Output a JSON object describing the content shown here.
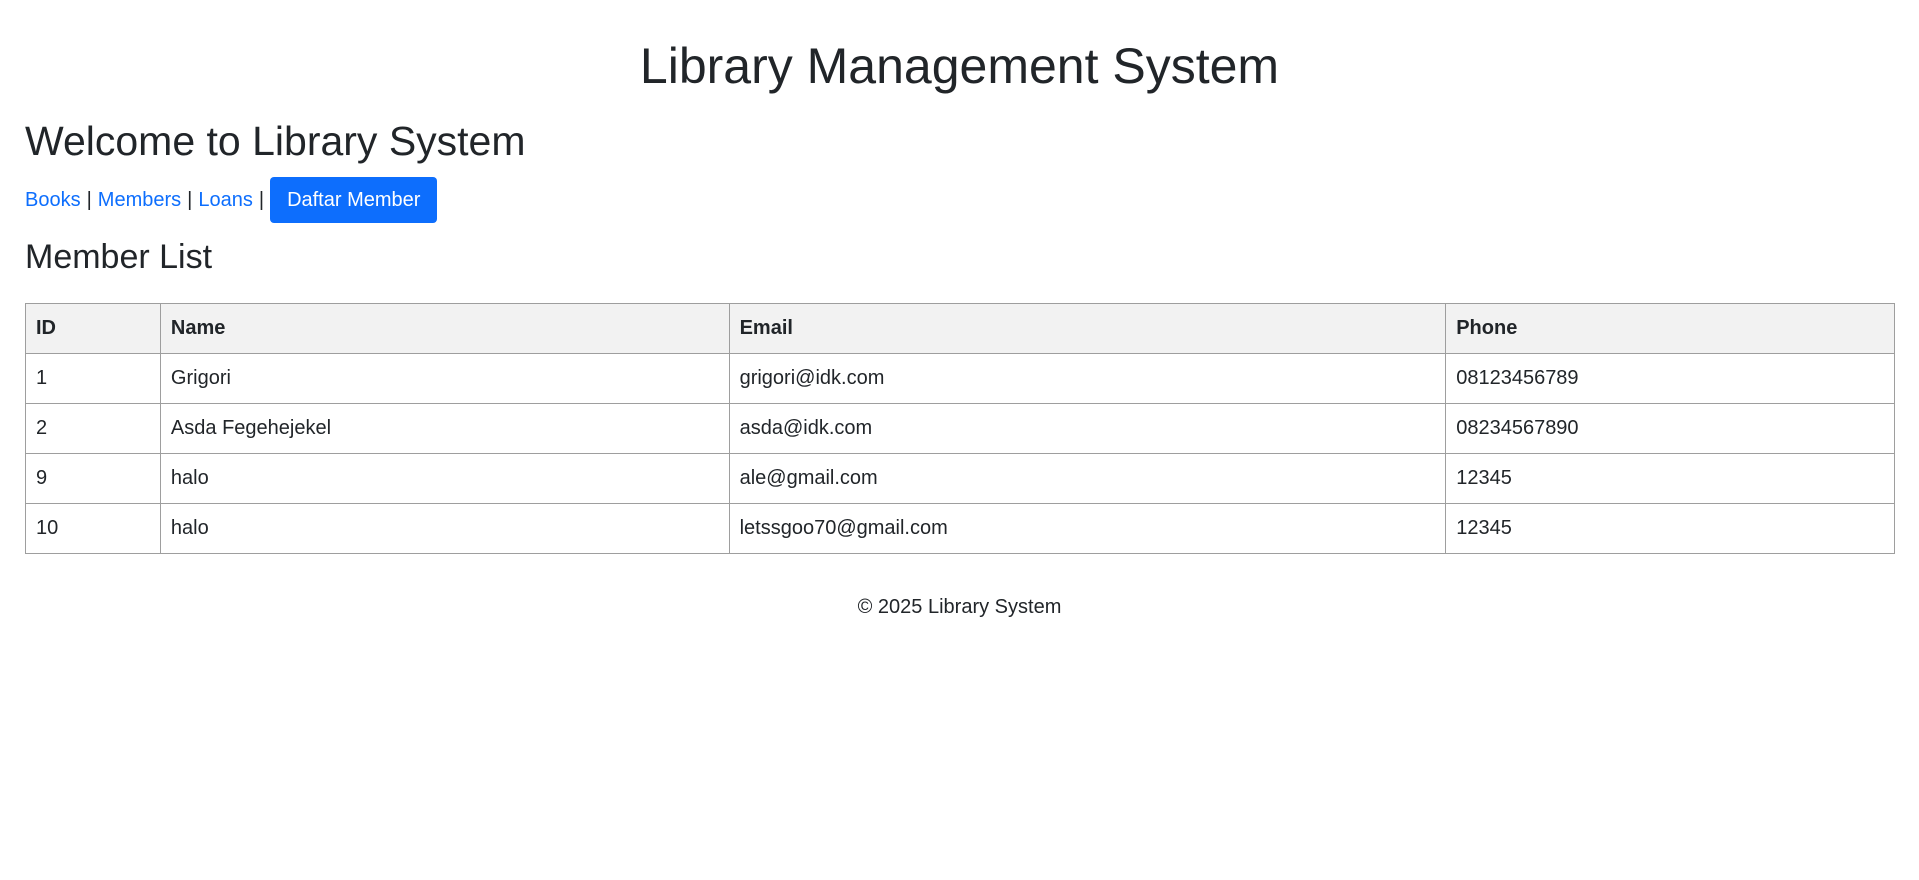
{
  "header": {
    "title": "Library Management System"
  },
  "welcome": "Welcome to Library System",
  "nav": {
    "books": "Books",
    "members": "Members",
    "loans": "Loans",
    "separator": "|",
    "register_button": "Daftar Member"
  },
  "section_title": "Member List",
  "table": {
    "headers": [
      "ID",
      "Name",
      "Email",
      "Phone"
    ],
    "rows": [
      [
        "1",
        "Grigori",
        "grigori@idk.com",
        "08123456789"
      ],
      [
        "2",
        "Asda Fegehejekel",
        "asda@idk.com",
        "08234567890"
      ],
      [
        "9",
        "halo",
        "ale@gmail.com",
        "12345"
      ],
      [
        "10",
        "halo",
        "letssgoo70@gmail.com",
        "12345"
      ]
    ]
  },
  "footer": "© 2025 Library System",
  "colors": {
    "link": "#0d6efd",
    "button_bg": "#0d6efd",
    "table_header_bg": "#f2f2f2",
    "border": "#9e9e9e"
  }
}
